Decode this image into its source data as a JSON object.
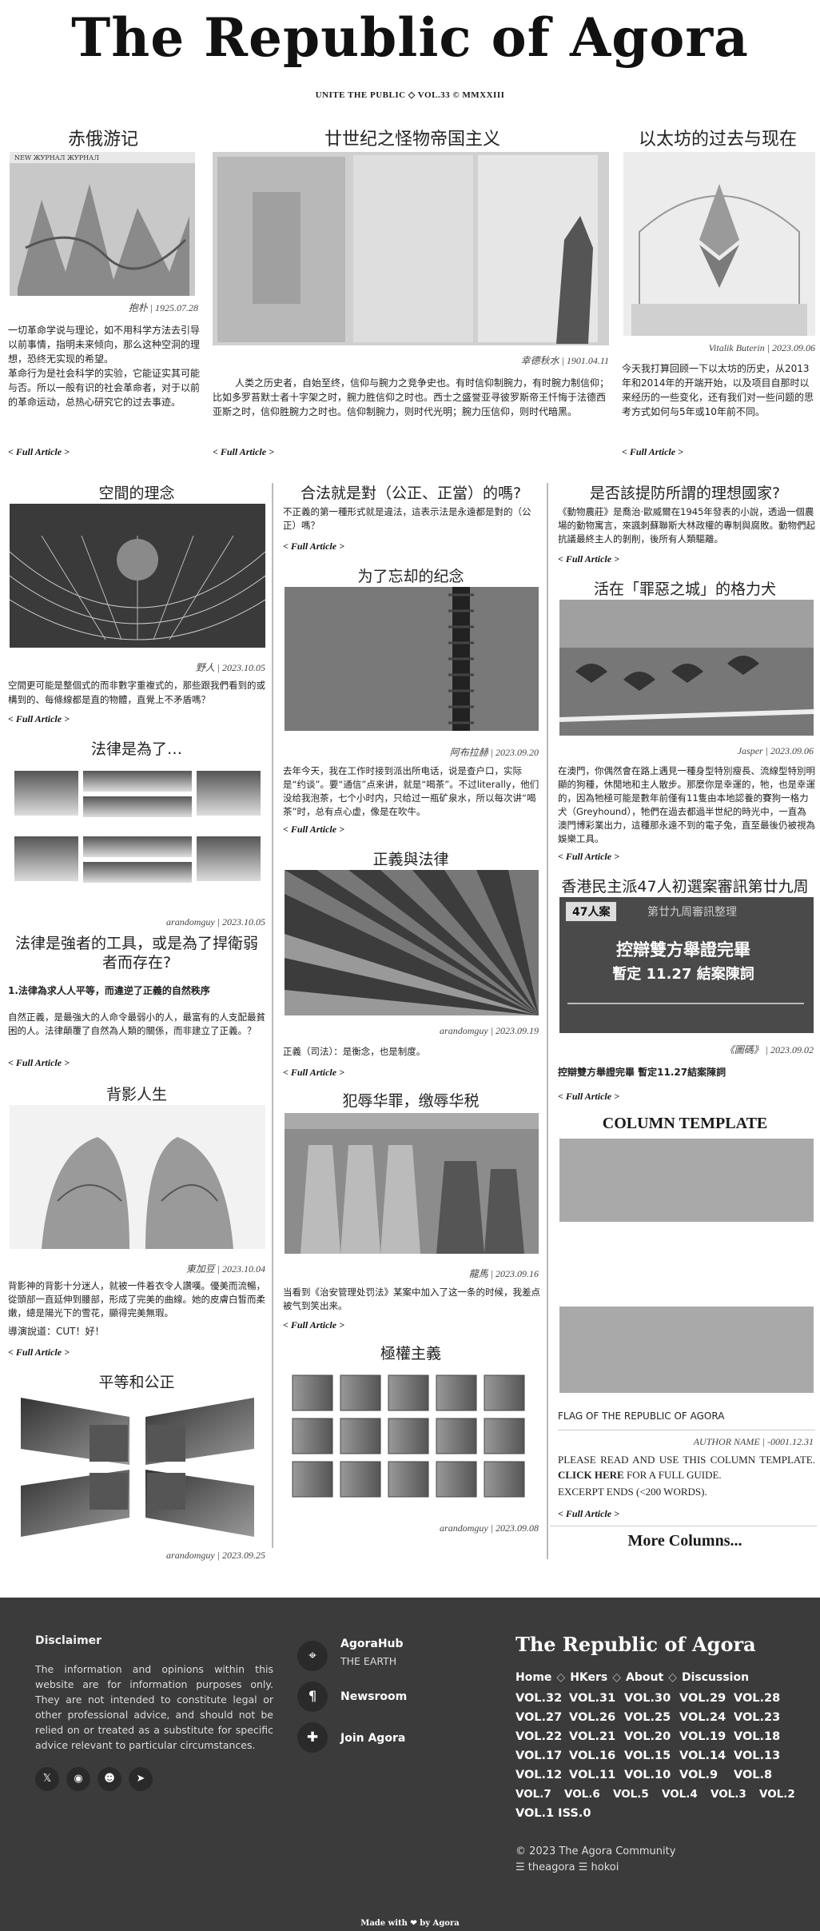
{
  "masthead": {
    "title": "The Republic of Agora",
    "subline": "UNITE THE PUBLIC ◇ VOL.33 © MMXXIII"
  },
  "top_articles": [
    {
      "title": "赤俄游记",
      "meta": "抱朴 | 1925.07.28",
      "excerpt": "一切革命学说与理论，如不用科学方法去引导以前事情，指明未来倾向，那么这种空洞的理想，恐终无实现的希望。\n革命行为是社会科学的实验，它能证实其可能与否。所以一般有识的社会革命者，对于以前的革命运动，总热心研究它的过去事迹。",
      "more": "< Full Article >"
    },
    {
      "title": "廿世纪之怪物帝国主义",
      "meta": "幸德秋水 | 1901.04.11",
      "excerpt": "人类之历史者，自始至终，信仰与腕力之竞争史也。有时信仰制腕力，有时腕力制信仰；比如多罗苔默士者十字架之时，腕力胜信仰之时也。西士之盛誉亚寻彼罗斯帝王忏悔于法德西亚斯之时，信仰胜腕力之时也。信仰制腕力，则时代光明；腕力压信仰，则时代暗黑。",
      "more": "< Full Article >"
    },
    {
      "title": "以太坊的过去与现在",
      "meta": "Vitalik Buterin | 2023.09.06",
      "excerpt": "今天我打算回顾一下以太坊的历史，从2013年和2014年的开端开始，以及项目自那时以来经历的一些变化，还有我们对一些问题的思考方式如何与5年或10年前不同。",
      "more": "< Full Article >"
    }
  ],
  "col1": [
    {
      "title": "空間的理念",
      "meta": "野人 | 2023.10.05",
      "excerpt": "空間更可能是整個式的而非數字重複式的，那些跟我們看到的或構到的、每條線都是直的物體，直覺上不矛盾嗎？",
      "more": "< Full Article >"
    },
    {
      "title": "法律是為了…",
      "meta": "arandomguy | 2023.10.05"
    },
    {
      "title": "法律是強者的工具，或是為了捍衛弱者而存在?",
      "subtitle": "1.法律為求人人平等，而違逆了正義的自然秩序",
      "excerpt": "自然正義，是最強大的人命令最弱小的人，最富有的人支配最貧困的人。法律顛覆了自然為人類的關係，而非建立了正義。？",
      "more": "< Full Article >"
    },
    {
      "title": "背影人生",
      "meta": "東加豆 | 2023.10.04",
      "excerpt": "背影神的背影十分迷人，就被一件着衣令人讚嘆。優美而流暢，從頭部一直延伸到腰部，形成了完美的曲線。她的皮膚白皙而柔嫩，總是陽光下的雪花，顯得完美無瑕。",
      "excerpt2": "導演說道：CUT！好！",
      "more": "< Full Article >"
    },
    {
      "title": "平等和公正",
      "meta": "arandomguy | 2023.09.25"
    }
  ],
  "col2": [
    {
      "title": "合法就是對（公正、正當）的嗎?",
      "excerpt": "不正義的第一種形式就是違法，這表示法是永遠都是對的（公正）嗎？",
      "more": "< Full Article >"
    },
    {
      "title": "为了忘却的纪念",
      "meta": "阿布拉赫 | 2023.09.20",
      "excerpt": "去年今天，我在工作时接到派出所电话，说是查户口，实际是“约谈”。要“通信”点来讲，就是“喝茶”。不过literally，他们没给我泡茶，七个小时内，只给过一瓶矿泉水，所以每次讲“喝茶”时，总有点心虚，像是在吹牛。",
      "more": "< Full Article >"
    },
    {
      "title": "正義與法律",
      "meta": "arandomguy | 2023.09.19",
      "excerpt": "正義（司法）：是衡念，也是制度。",
      "more": "< Full Article >"
    },
    {
      "title": "犯辱华罪，缴辱华税",
      "meta": "龍馬 | 2023.09.16",
      "excerpt": "当看到《治安管理处罚法》某案中加入了这一条的时候，我差点被气到笑出来。",
      "more": "< Full Article >"
    },
    {
      "title": "極權主義",
      "meta": "arandomguy | 2023.09.08"
    }
  ],
  "col3": [
    {
      "title": "是否該提防所謂的理想國家?",
      "excerpt": "《動物農莊》是喬治·歐威爾在1945年發表的小說，透過一個農場的動物寓言，來諷刺蘇聯斯大林政權的專制與腐敗。動物們起抗議最終主人的剝削，後所有人類驅離。",
      "more": "< Full Article >"
    },
    {
      "title": "活在「罪惡之城」的格力犬",
      "meta": "Jasper | 2023.09.06",
      "excerpt": "在澳門，你偶然會在路上遇見一種身型特別瘦長、流線型特別明顯的狗種，休閒地和主人散步。那麼你是幸運的，牠，也是幸運的，因為牠極可能是數年前僅有11隻由本地認養的賽狗一格力犬（Greyhound），牠們在過去都過半世紀的時光中，一直為澳門博彩業出力，這種那永遠不到的電子兔，直至最後仍被視為娛樂工具。",
      "more": "< Full Article >"
    },
    {
      "title": "香港民主派47人初選案審訊第廿九周",
      "img_badge": "47人案",
      "img_banner": "第廿九周審訊整理",
      "img_main": "控辯雙方舉證完畢",
      "img_sub": "暫定 11.27 結案陳詞",
      "meta": "《圖碼》 | 2023.09.02",
      "excerpt": "控辯雙方舉證完畢 暫定11.27結案陳詞",
      "more": "< Full Article >"
    },
    {
      "template_title": "COLUMN TEMPLATE",
      "flag": "FLAG OF THE REPUBLIC OF AGORA",
      "meta": "AUTHOR NAME | -0001.12.31",
      "body1": "PLEASE READ AND USE THIS COLUMN TEMPLATE. ",
      "body_link": "CLICK HERE",
      "body2": " FOR A FULL GUIDE.",
      "body3": "EXCERPT ENDS (<200 WORDS).",
      "more": "< Full Article >"
    },
    {
      "more_columns": "More Columns..."
    }
  ],
  "footer": {
    "disclaimer_title": "Disclaimer",
    "disclaimer_text": "The information and opinions within this website are for information purposes only. They are not intended to constitute legal or other professional advice, and should not be relied on or treated as a substitute for specific advice relevant to particular circumstances.",
    "links": [
      {
        "icon": "location-icon",
        "title": "AgoraHub",
        "subtitle": "THE EARTH"
      },
      {
        "icon": "paragraph-icon",
        "title": "Newsroom"
      },
      {
        "icon": "puzzle-icon",
        "title": "Join Agora"
      }
    ],
    "brand": "The Republic of Agora",
    "nav": [
      "Home",
      "HKers",
      "About",
      "Discussion"
    ],
    "nav_sep": "◇",
    "volumes": [
      [
        "VOL.32",
        "VOL.31",
        "VOL.30",
        "VOL.29",
        "VOL.28"
      ],
      [
        "VOL.27",
        "VOL.26",
        "VOL.25",
        "VOL.24",
        "VOL.23"
      ],
      [
        "VOL.22",
        "VOL.21",
        "VOL.20",
        "VOL.19",
        "VOL.18"
      ],
      [
        "VOL.17",
        "VOL.16",
        "VOL.15",
        "VOL.14",
        "VOL.13"
      ],
      [
        "VOL.12",
        "VOL.11",
        "VOL.10",
        "VOL.9",
        "VOL.8"
      ],
      [
        "VOL.7",
        "VOL.6",
        "VOL.5",
        "VOL.4",
        "VOL.3",
        "VOL.2"
      ],
      [
        "VOL.1 ISS.0"
      ]
    ],
    "copyright": "© 2023 The Agora Community",
    "credits": "☰ theagora ☰ hokoi",
    "made_with": "Made with ❤ by Agora"
  }
}
